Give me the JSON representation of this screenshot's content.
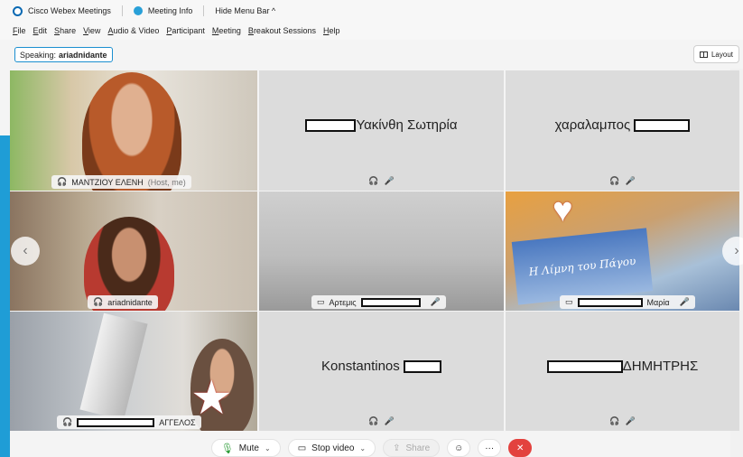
{
  "titlebar": {
    "app_name": "Cisco Webex Meetings",
    "meeting_info": "Meeting Info",
    "hide_menu": "Hide Menu Bar ^"
  },
  "menu": [
    "File",
    "Edit",
    "Share",
    "View",
    "Audio & Video",
    "Participant",
    "Meeting",
    "Breakout Sessions",
    "Help"
  ],
  "speaking": {
    "label": "Speaking:",
    "name": "ariadnidante"
  },
  "layout_button": "Layout",
  "tiles": {
    "t1": {
      "label": "ΜΑΝΤΖΙΟΥ ΕΛΕΝΗ",
      "suffix": "(Host, me)"
    },
    "t2": {
      "name": "Υακίνθη Σωτηρία"
    },
    "t3": {
      "name": "χαραλαμπος"
    },
    "t4": {
      "label": "ariadnidante"
    },
    "t5": {
      "label": "Αρτεμις"
    },
    "t6": {
      "label": "Μαρία",
      "book_title": "Η Λίμνη του Πάγου"
    },
    "t7": {
      "label": "ΑΓΓΕΛΟΣ"
    },
    "t8": {
      "name": "Konstantinos"
    },
    "t9": {
      "name": "ΔΗΜΗΤΡΗΣ"
    }
  },
  "controls": {
    "mute": "Mute",
    "stop_video": "Stop video",
    "share": "Share"
  },
  "colors": {
    "accent": "#1e9bd7",
    "end_call": "#e3423e",
    "mic_on": "#2c9c38"
  }
}
